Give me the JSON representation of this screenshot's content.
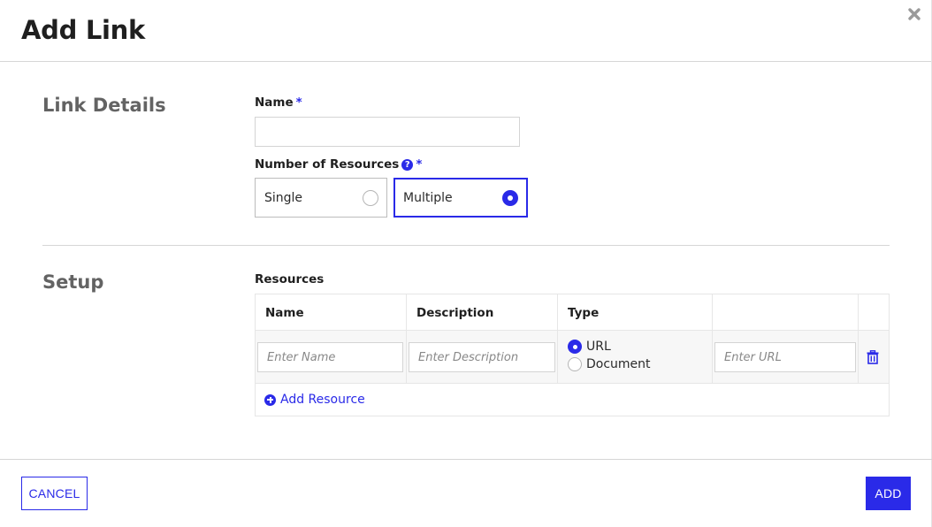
{
  "dialog": {
    "title": "Add Link",
    "close_icon": "close-icon"
  },
  "link_details": {
    "section_title": "Link Details",
    "name_label": "Name",
    "required_marker": "*",
    "name_value": "",
    "name_placeholder": "",
    "resources_count_label": "Number of Resources",
    "help_icon": "?",
    "options": [
      {
        "label": "Single",
        "selected": false
      },
      {
        "label": "Multiple",
        "selected": true
      }
    ]
  },
  "setup": {
    "section_title": "Setup",
    "resources_label": "Resources",
    "columns": [
      "Name",
      "Description",
      "Type",
      "",
      ""
    ],
    "rows": [
      {
        "name_placeholder": "Enter Name",
        "description_placeholder": "Enter Description",
        "type_options": [
          {
            "label": "URL",
            "selected": true
          },
          {
            "label": "Document",
            "selected": false
          }
        ],
        "url_placeholder": "Enter URL",
        "delete_icon": "trash-icon"
      }
    ],
    "add_resource_label": "Add Resource"
  },
  "footer": {
    "cancel_label": "CANCEL",
    "add_label": "ADD"
  },
  "colors": {
    "accent": "#2a2ae8",
    "section_title": "#636363",
    "border": "#d6d6d6"
  }
}
